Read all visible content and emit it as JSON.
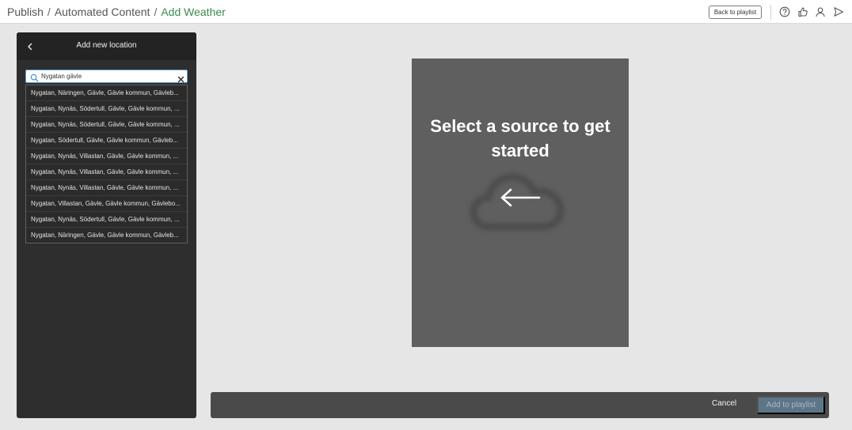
{
  "breadcrumb": [
    {
      "label": "Publish"
    },
    {
      "label": "Automated Content"
    },
    {
      "label": "Add Weather"
    }
  ],
  "breadcrumb_separator": "/",
  "header": {
    "back_to_playlist": "Back to playlist",
    "icons": [
      "help-icon",
      "thumbs-up-icon",
      "user-icon",
      "send-icon"
    ]
  },
  "panel": {
    "title": "Add new location",
    "search": {
      "value": "Nygatan gävle",
      "placeholder": ""
    },
    "results": [
      "Nygatan, Näringen, Gävle, Gävle kommun, Gävleb...",
      "Nygatan, Nynäs, Södertull, Gävle, Gävle kommun, ...",
      "Nygatan, Nynäs, Södertull, Gävle, Gävle kommun, ...",
      "Nygatan, Södertull, Gävle, Gävle kommun, Gävleb...",
      "Nygatan, Nynäs, Villastan, Gävle, Gävle kommun, ...",
      "Nygatan, Nynäs, Villastan, Gävle, Gävle kommun, ...",
      "Nygatan, Nynäs, Villastan, Gävle, Gävle kommun, ...",
      "Nygatan, Villastan, Gävle, Gävle kommun, Gävlebo...",
      "Nygatan, Nynäs, Södertull, Gävle, Gävle kommun, ...",
      "Nygatan, Näringen, Gävle, Gävle kommun, Gävleb..."
    ]
  },
  "preview": {
    "message": "Select a source to get started"
  },
  "footer": {
    "cancel": "Cancel",
    "add": "Add to playlist"
  },
  "colors": {
    "accent_green": "#3c8a4c",
    "panel_bg": "#2e2e2e",
    "preview_bg": "#5f5f5f",
    "add_button": "#5d7687"
  }
}
